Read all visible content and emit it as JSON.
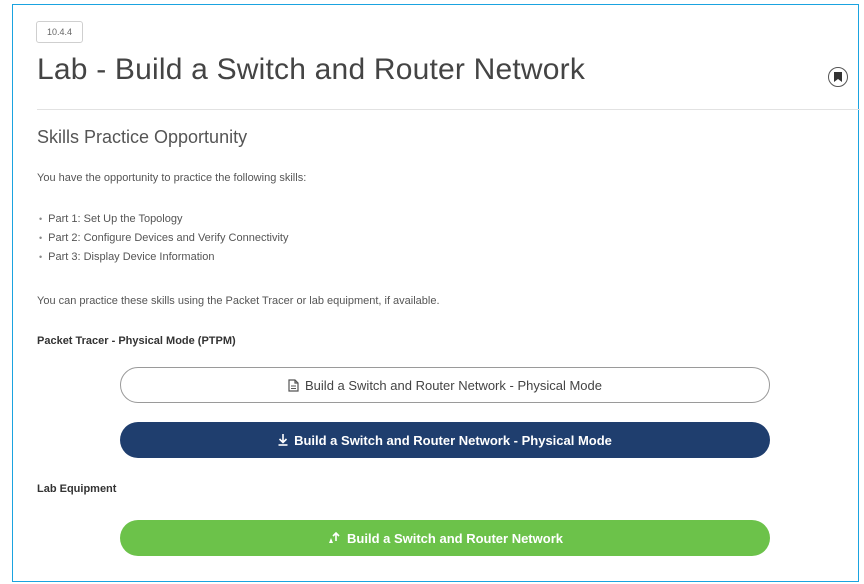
{
  "badge": "10.4.4",
  "title": "Lab - Build a Switch and Router Network",
  "icons": {
    "bookmark": "bookmark-icon",
    "file": "file-icon",
    "download": "download-icon",
    "lab": "lab-equipment-icon"
  },
  "subtitle": "Skills Practice Opportunity",
  "intro": "You have the opportunity to practice the following skills:",
  "parts": [
    "Part 1: Set Up the Topology",
    "Part 2: Configure Devices and Verify Connectivity",
    "Part 3: Display Device Information"
  ],
  "practice_text": "You can practice these skills using the Packet Tracer or lab equipment, if available.",
  "ptpm_label": "Packet Tracer - Physical Mode (PTPM)",
  "buttons": {
    "instructions": "Build a Switch and Router Network - Physical Mode",
    "download": "Build a Switch and Router Network - Physical Mode",
    "lab": "Build a Switch and Router Network"
  },
  "lab_equipment_label": "Lab Equipment",
  "colors": {
    "frame": "#1aa3e0",
    "navy": "#1f3e6e",
    "green": "#6cc24a"
  }
}
